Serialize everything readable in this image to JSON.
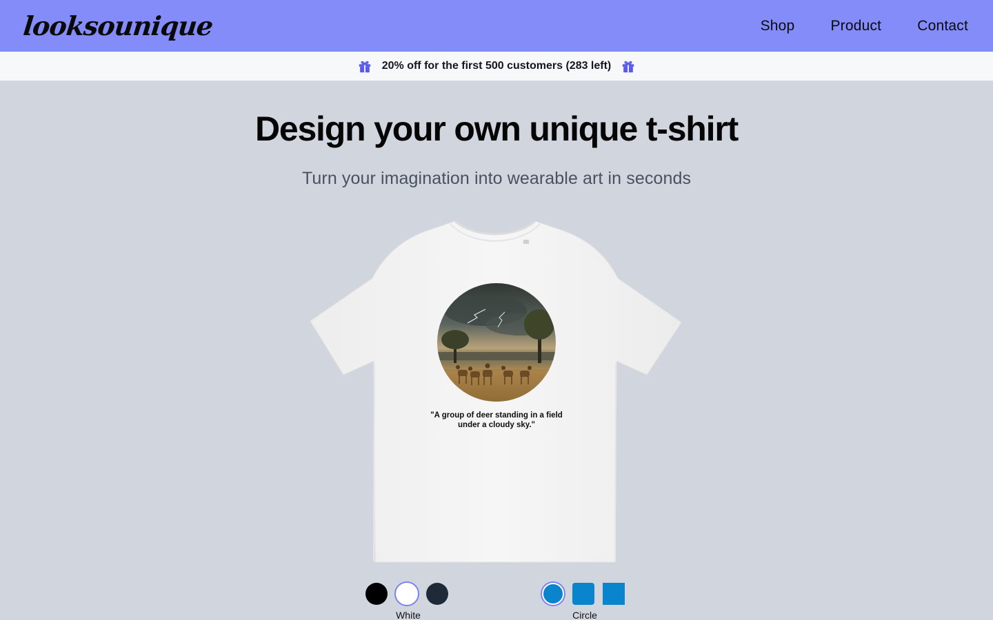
{
  "header": {
    "logo": "looksounique",
    "nav": [
      "Shop",
      "Product",
      "Contact"
    ],
    "background_color": "#838cf8"
  },
  "promo": {
    "text": "20% off for the first 500 customers (283 left)",
    "icon": "gift-icon",
    "icon_color": "#5b5ce6"
  },
  "hero": {
    "title": "Design your own unique t-shirt",
    "subtitle": "Turn your imagination into wearable art in seconds"
  },
  "product": {
    "shirt_color": "white",
    "caption": "\"A group of deer standing in a field under a cloudy sky.\""
  },
  "options": {
    "colors": [
      {
        "name": "Black",
        "hex": "#000000",
        "selected": false
      },
      {
        "name": "White",
        "hex": "#ffffff",
        "selected": true
      },
      {
        "name": "Navy",
        "hex": "#1f2a38",
        "selected": false
      }
    ],
    "color_label": "White",
    "shapes": [
      {
        "name": "Circle",
        "selected": true
      },
      {
        "name": "Rounded",
        "selected": false
      },
      {
        "name": "Square",
        "selected": false
      }
    ],
    "shape_label": "Circle",
    "accent_color": "#0a84cc"
  }
}
